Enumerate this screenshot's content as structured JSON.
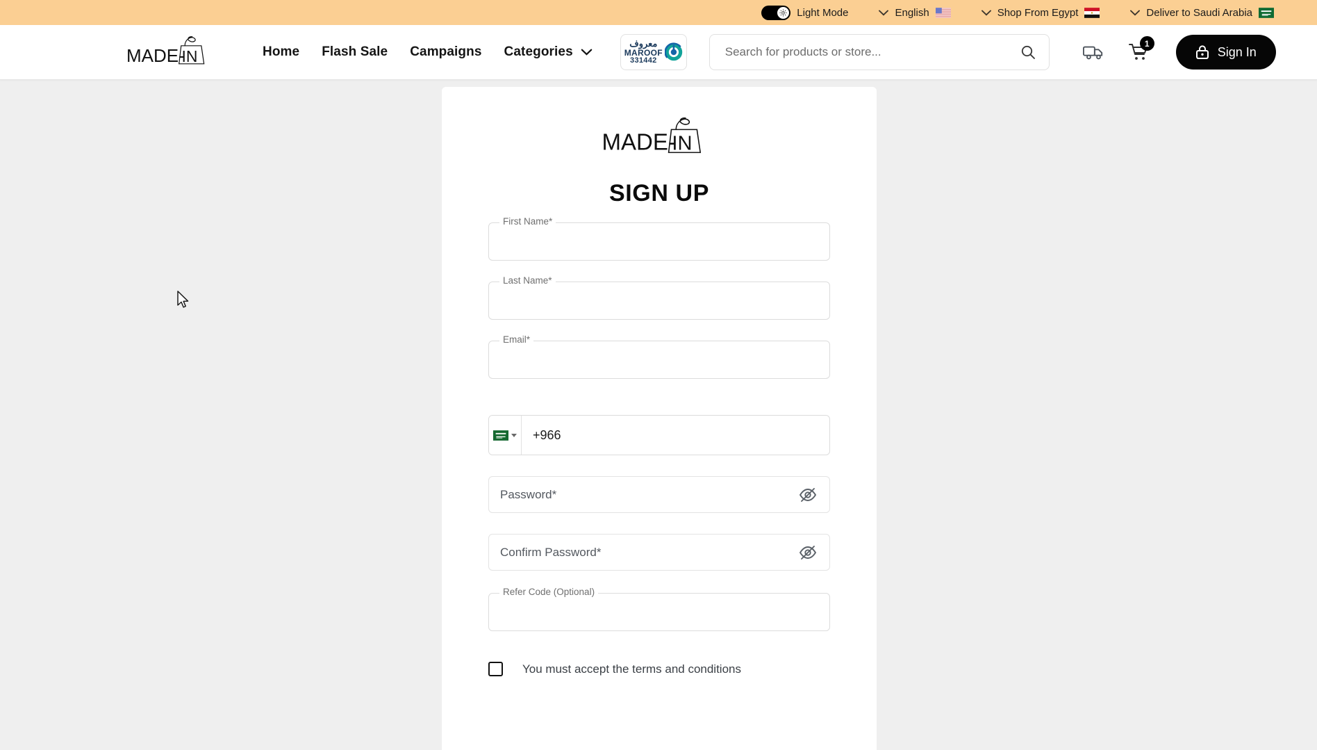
{
  "topbar": {
    "theme_toggle_label": "Light Mode",
    "theme_toggle_state": "light",
    "language": "English",
    "language_flag": "us-flag",
    "shop_from": "Shop From Egypt",
    "shop_from_flag": "eg-flag",
    "deliver_to": "Deliver to Saudi Arabia",
    "deliver_to_flag": "sa-flag",
    "background_color": "#fbcf93"
  },
  "header": {
    "brand": "MADE-IN",
    "nav": [
      {
        "label": "Home",
        "has_dropdown": false
      },
      {
        "label": "Flash Sale",
        "has_dropdown": false
      },
      {
        "label": "Campaigns",
        "has_dropdown": false
      },
      {
        "label": "Categories",
        "has_dropdown": true
      }
    ],
    "maroof": {
      "arabic": "معروف",
      "english": "MAROOF",
      "number": "331442"
    },
    "search": {
      "placeholder": "Search for products or store...",
      "value": ""
    },
    "track_order_icon": "truck-icon",
    "cart": {
      "icon": "cart-icon",
      "count": "1"
    },
    "sign_in": {
      "label": "Sign In",
      "icon": "lock-icon"
    }
  },
  "signup": {
    "logo_text": "MADE-IN",
    "title": "SIGN UP",
    "fields": {
      "first_name": {
        "label": "First Name",
        "required_mark": "*",
        "value": ""
      },
      "last_name": {
        "label": "Last Name",
        "required_mark": "*",
        "value": ""
      },
      "email": {
        "label": "Email",
        "required_mark": "*",
        "value": ""
      },
      "phone": {
        "country_flag": "sa-flag",
        "dial_code": "+966",
        "value": "+966"
      },
      "password": {
        "placeholder": "Password*",
        "value": "",
        "toggle_icon": "eye-off-icon"
      },
      "confirm_password": {
        "placeholder": "Confirm Password*",
        "value": "",
        "toggle_icon": "eye-off-icon"
      },
      "refer_code": {
        "label": "Refer Code (Optional)",
        "value": ""
      }
    },
    "terms": {
      "checked": false,
      "text": "You must accept the terms and conditions"
    }
  },
  "colors": {
    "accent": "#fbcf93",
    "button": "#060606",
    "page_bg": "#efefef",
    "card_bg": "#ffffff"
  }
}
